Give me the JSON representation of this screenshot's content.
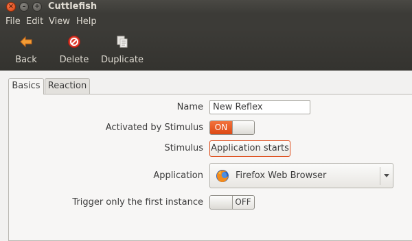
{
  "window": {
    "title": "Cuttlefish",
    "controls": {
      "close_glyph": "×",
      "minimize_glyph": "–",
      "maximize_glyph": "+"
    }
  },
  "menubar": {
    "items": [
      {
        "label": "File"
      },
      {
        "label": "Edit"
      },
      {
        "label": "View"
      },
      {
        "label": "Help"
      }
    ]
  },
  "toolbar": {
    "buttons": [
      {
        "label": "Back",
        "icon": "back-arrow-icon"
      },
      {
        "label": "Delete",
        "icon": "delete-icon"
      },
      {
        "label": "Duplicate",
        "icon": "duplicate-icon"
      }
    ]
  },
  "tabs": [
    {
      "label": "Basics",
      "active": true
    },
    {
      "label": "Reaction",
      "active": false
    }
  ],
  "form": {
    "name": {
      "label": "Name",
      "value": "New Reflex"
    },
    "activated": {
      "label": "Activated by Stimulus",
      "state": "ON"
    },
    "stimulus": {
      "label": "Stimulus",
      "value": "Application starts"
    },
    "application": {
      "label": "Application",
      "value": "Firefox Web Browser",
      "icon": "firefox-icon"
    },
    "first_instance": {
      "label": "Trigger only the first instance",
      "state": "OFF"
    }
  },
  "colors": {
    "accent": "#dd4814",
    "chrome_dark": "#3c3b37",
    "chrome_text": "#dfdbd2",
    "panel_bg": "#f2f1f0"
  }
}
